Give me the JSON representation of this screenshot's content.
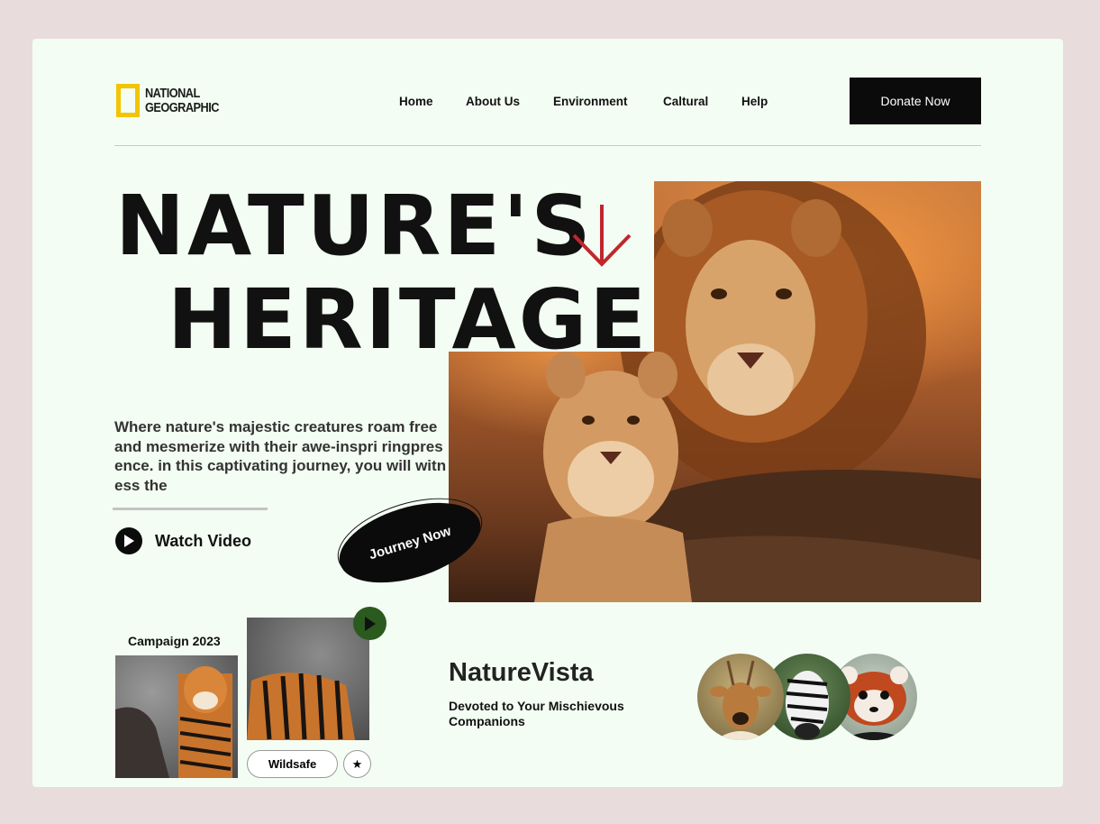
{
  "header": {
    "logo_line1": "NATIONAL",
    "logo_line2": "GEOGRAPHIC",
    "nav": [
      {
        "label": "Home"
      },
      {
        "label": "About Us"
      },
      {
        "label": "Environment"
      },
      {
        "label": "Caltural"
      },
      {
        "label": "Help"
      }
    ],
    "cta_label": "Donate Now"
  },
  "hero": {
    "title_line1": "NATURE'S",
    "title_line2": "HERITAGE",
    "arrow_icon": "arrow-down-icon",
    "arrow_color": "#c0272d",
    "description": "Where nature's majestic creatures roam free and mesmerize with their awe-inspri ringpresence. in this captivating journey, you will witness the",
    "watch_label": "Watch Video",
    "journey_label": "Journey Now",
    "image_subject": "lion and lion cub at sunset"
  },
  "campaign": {
    "label": "Campaign 2023",
    "tag_label": "Wildsafe",
    "star_glyph": "★",
    "play_color": "#2b5a1f"
  },
  "vista": {
    "title": "NatureVista",
    "subtitle": "Devoted to Your Mischievous Companions",
    "avatars": [
      {
        "subject": "deer"
      },
      {
        "subject": "zebra"
      },
      {
        "subject": "red panda"
      }
    ]
  },
  "colors": {
    "page_bg": "#e8dcdc",
    "card_bg": "#f3fdf3",
    "accent_dark": "#0b0b0b",
    "logo_yellow": "#f2c500"
  }
}
